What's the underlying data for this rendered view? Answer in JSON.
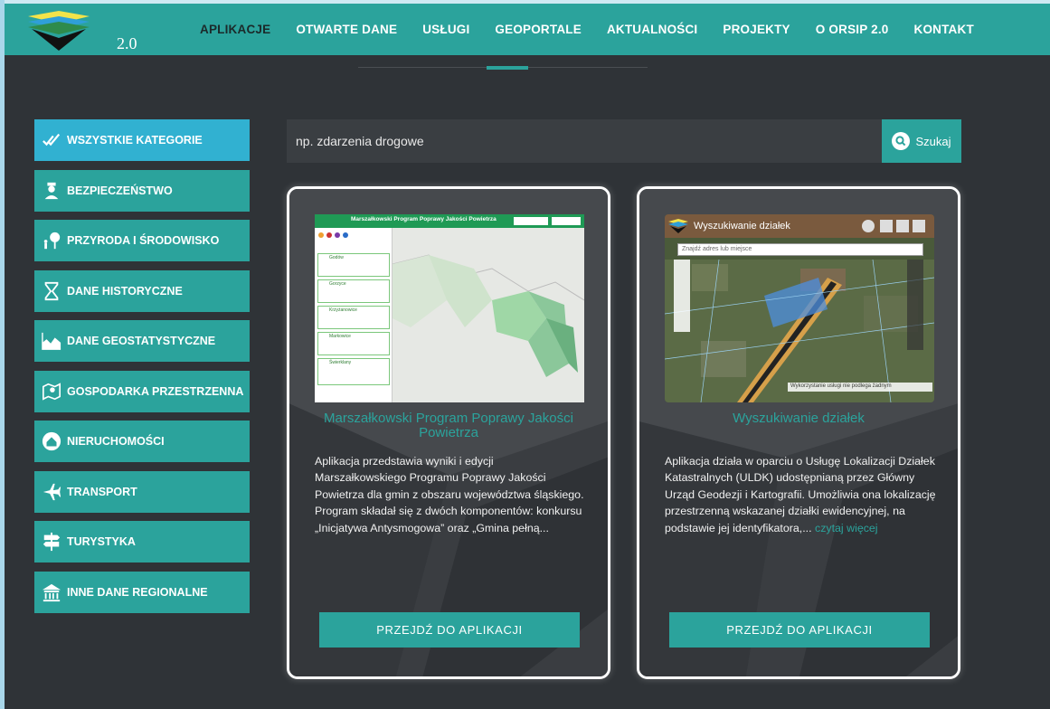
{
  "logo": {
    "version": "2.0"
  },
  "nav": {
    "items": [
      {
        "label": "APLIKACJE"
      },
      {
        "label": "OTWARTE DANE"
      },
      {
        "label": "USŁUGI"
      },
      {
        "label": "GEOPORTALE"
      },
      {
        "label": "AKTUALNOŚCI"
      },
      {
        "label": "PROJEKTY"
      },
      {
        "label": "O ORSIP 2.0"
      },
      {
        "label": "KONTAKT"
      }
    ]
  },
  "sidebar": {
    "items": [
      {
        "label": "WSZYSTKIE KATEGORIE"
      },
      {
        "label": "BEZPIECZEŃSTWO"
      },
      {
        "label": "PRZYRODA I ŚRODOWISKO"
      },
      {
        "label": "DANE HISTORYCZNE"
      },
      {
        "label": "DANE GEOSTATYSTYCZNE"
      },
      {
        "label": "GOSPODARKA PRZESTRZENNA"
      },
      {
        "label": "NIERUCHOMOŚCI"
      },
      {
        "label": "TRANSPORT"
      },
      {
        "label": "TURYSTYKA"
      },
      {
        "label": "INNE DANE REGIONALNE"
      }
    ]
  },
  "search": {
    "placeholder": "np. zdarzenia drogowe",
    "button_label": "Szukaj"
  },
  "cards": [
    {
      "title": "Marszałkowski Program Poprawy Jakości Powietrza",
      "description": "Aplikacja przedstawia wyniki i edycji Marszałkowskiego Programu Poprawy Jakości Powietrza dla gmin z obszaru województwa śląskiego. Program składał się z dwóch komponentów: konkursu „Inicjatywa Antysmogowa” oraz „Gmina pełną...",
      "more_label": "",
      "button_label": "PRZEJDŹ DO APLIKACJI",
      "shot_header": "Marszałkowski Program Poprawy Jakości Powietrza",
      "shot_list": [
        "Godów",
        "Gorzyce",
        "Krzyżanowice",
        "Markowice",
        "Świerklany"
      ]
    },
    {
      "title": "Wyszukiwanie działek",
      "description": "Aplikacja działa w oparciu o Usługę Lokalizacji Działek Katastralnych (ULDK) udostępnianą przez Główny Urząd Geodezji i Kartografii. Umożliwia ona lokalizację przestrzenną wskazanej działki ewidencyjnej, na podstawie jej identyfikatora,...",
      "more_label": "czytaj więcej",
      "button_label": "PRZEJDŹ DO APLIKACJI",
      "shot_header": "Wyszukiwanie działek",
      "shot_search": "Znajdź adres lub miejsce",
      "shot_footer": "Wykorzystanie usługi nie podlega żadnym"
    }
  ],
  "colors": {
    "accent": "#2ba39c",
    "active": "#31b1d1",
    "background": "#2f3337"
  }
}
